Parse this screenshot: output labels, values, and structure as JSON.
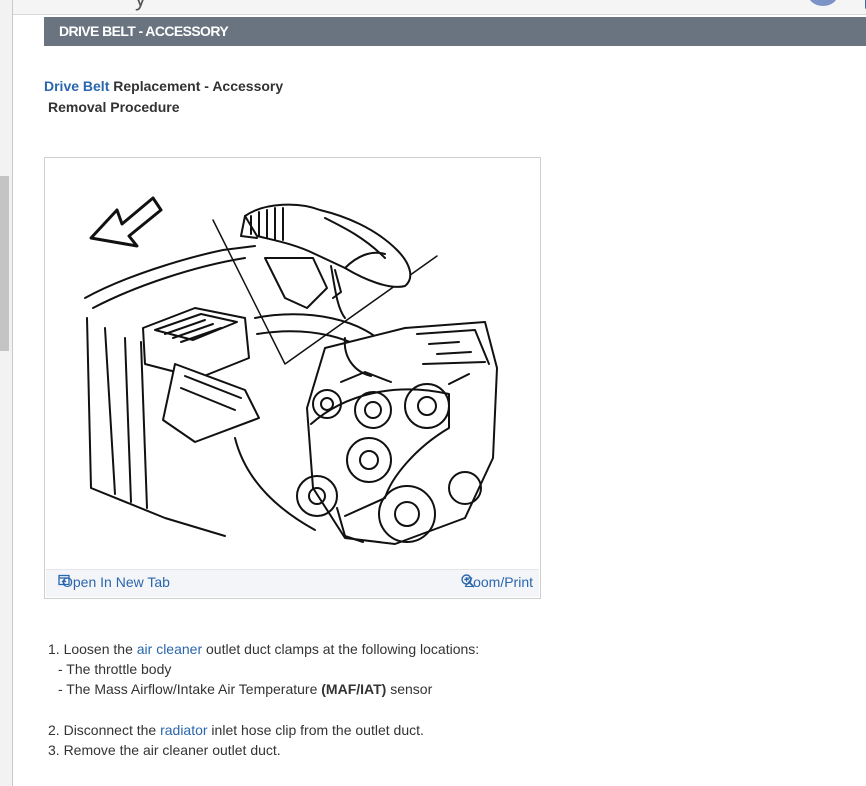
{
  "section": {
    "title": "DRIVE BELT - ACCESSORY"
  },
  "doc": {
    "title_link": "Drive Belt",
    "title_rest": " Replacement - Accessory",
    "subtitle": "Removal Procedure"
  },
  "figure": {
    "open_label": "Open In New Tab",
    "zoom_label": "Zoom/Print",
    "open_icon": "open-in-new-tab-icon",
    "zoom_icon": "zoom-in-icon"
  },
  "steps": {
    "s1_num": "1.",
    "s1_pre": " Loosen the ",
    "s1_link": "air cleaner",
    "s1_post": " outlet duct clamps at the following locations:",
    "s1a": "-  The throttle body",
    "s1b_pre": "-  The Mass Airflow/Intake Air Temperature ",
    "s1b_bold": "(MAF/IAT)",
    "s1b_post": " sensor",
    "s2_num": "2.",
    "s2_pre": " Disconnect the ",
    "s2_link": "radiator",
    "s2_post": " inlet hose clip from the outlet duct.",
    "s3": "3. Remove the air cleaner outlet duct."
  },
  "colors": {
    "section_bar": "#6a7480",
    "link": "#2a66ad"
  }
}
